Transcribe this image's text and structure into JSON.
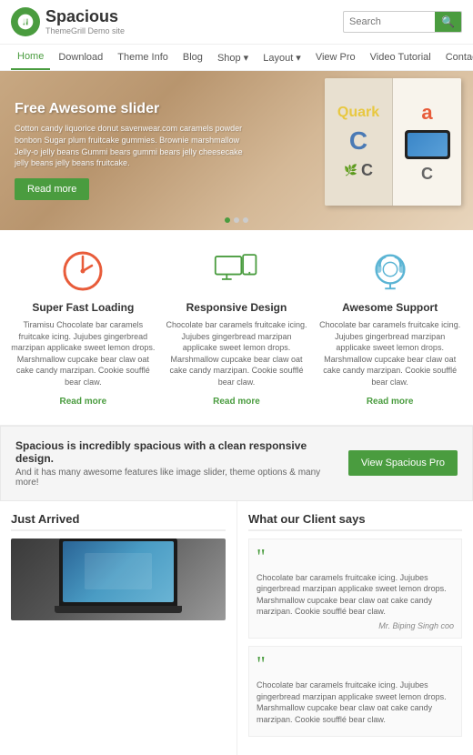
{
  "header": {
    "logo_name": "Spacious",
    "logo_sub": "ThemeGrill Demo site",
    "search_placeholder": "Search"
  },
  "nav": {
    "items": [
      {
        "label": "Home",
        "active": true
      },
      {
        "label": "Download",
        "active": false
      },
      {
        "label": "Theme Info",
        "active": false
      },
      {
        "label": "Blog",
        "active": false
      },
      {
        "label": "Shop ▾",
        "active": false
      },
      {
        "label": "Layout ▾",
        "active": false
      },
      {
        "label": "View Pro",
        "active": false
      },
      {
        "label": "Video Tutorial",
        "active": false
      },
      {
        "label": "Contact Us",
        "active": false
      }
    ]
  },
  "hero": {
    "title": "Free Awesome slider",
    "text": "Cotton candy liquorice donut savenwear.com caramels powder bonbon Sugar plum fruitcake gummies. Brownie marshmallow Jelly-o jelly beans Gummi bears gummi bears jelly cheesecake jelly beans jelly beans fruitcake.",
    "button_label": "Read more"
  },
  "features": [
    {
      "title": "Super Fast Loading",
      "text": "Tiramisu Chocolate bar caramels fruitcake icing. Jujubes gingerbread marzipan applicake sweet lemon drops. Marshmallow cupcake bear claw oat cake candy marzipan. Cookie soufflé bear claw.",
      "link": "Read more",
      "icon": "timer"
    },
    {
      "title": "Responsive Design",
      "text": "Chocolate bar caramels fruitcake icing. Jujubes gingerbread marzipan applicake sweet lemon drops. Marshmallow cupcake bear claw oat cake candy marzipan. Cookie soufflé bear claw.",
      "link": "Read more",
      "icon": "devices"
    },
    {
      "title": "Awesome Support",
      "text": "Chocolate bar caramels fruitcake icing. Jujubes gingerbread marzipan applicake sweet lemon drops. Marshmallow cupcake bear claw oat cake candy marzipan. Cookie soufflé bear claw.",
      "link": "Read more",
      "icon": "headset"
    }
  ],
  "cta": {
    "title": "Spacious is incredibly spacious with a clean responsive design.",
    "subtitle": "And it has many awesome features like image slider, theme options & many more!",
    "button_label": "View Spacious Pro"
  },
  "just_arrived": {
    "title": "Just Arrived"
  },
  "client_says": {
    "title": "What our Client says",
    "testimonials": [
      {
        "text": "Chocolate bar caramels fruitcake icing. Jujubes gingerbread marzipan applicake sweet lemon drops. Marshmallow cupcake bear claw oat cake candy marzipan. Cookie soufflé bear claw.",
        "author": "Mr. Biping Singh coo"
      },
      {
        "text": "Chocolate bar caramels fruitcake icing. Jujubes gingerbread marzipan applicake sweet lemon drops. Marshmallow cupcake bear claw oat cake candy marzipan. Cookie soufflé bear claw.",
        "author": ""
      }
    ]
  }
}
